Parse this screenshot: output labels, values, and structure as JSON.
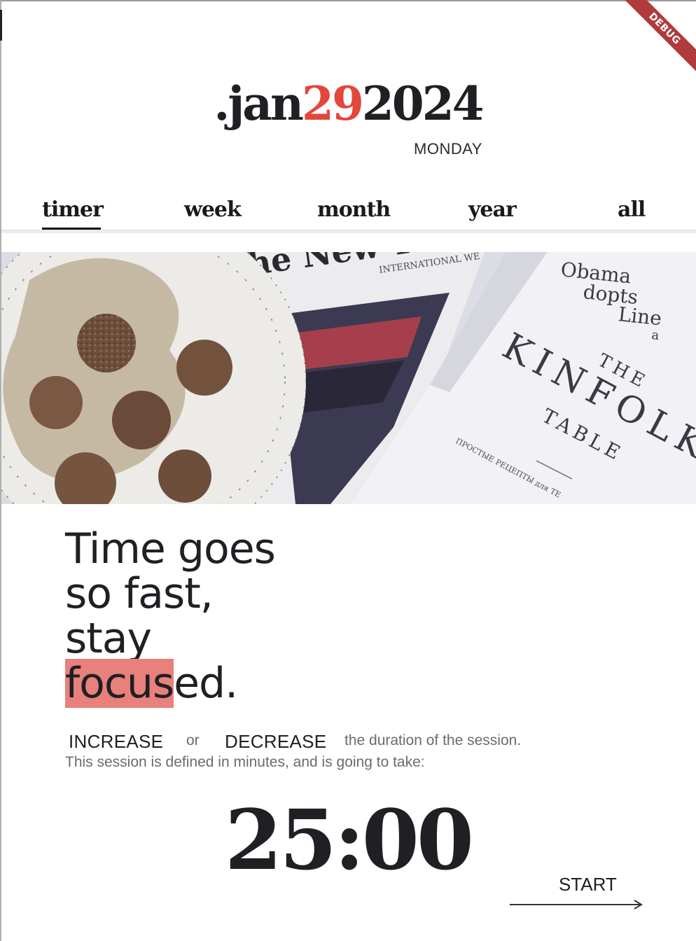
{
  "debug_banner": "DEBUG",
  "date": {
    "prefix": ".jan",
    "day": "29",
    "year": "2024",
    "weekday": "MONDAY"
  },
  "tabs": [
    {
      "label": "timer",
      "active": true
    },
    {
      "label": "week"
    },
    {
      "label": "month"
    },
    {
      "label": "year"
    },
    {
      "label": "all"
    }
  ],
  "hero": {
    "newspaper_masthead": "The New Yo",
    "newspaper_sub": "INTERNATIONAL WE",
    "headline": [
      "Obama",
      "dopts",
      "Line",
      "a"
    ],
    "magazine_title": [
      "THE",
      "KINFOLK",
      "TABLE"
    ],
    "magazine_caption": "ПРОСТЫЕ РЕЦЕПТЫ для ТЕ"
  },
  "quote": {
    "line1": "Time goes",
    "line2": "so fast,",
    "line3": "stay",
    "line4_highlight": "focus",
    "line4_rest": "ed."
  },
  "controls": {
    "increase": "INCREASE",
    "or": "or",
    "decrease": "DECREASE",
    "suffix": "the duration of the session.",
    "note": "This session is defined in minutes, and is going to take:"
  },
  "timer": {
    "value": "25:00"
  },
  "start": {
    "label": "START"
  },
  "colors": {
    "accent": "#e2473c",
    "highlight": "#e8807c",
    "text": "#1f1f24"
  }
}
